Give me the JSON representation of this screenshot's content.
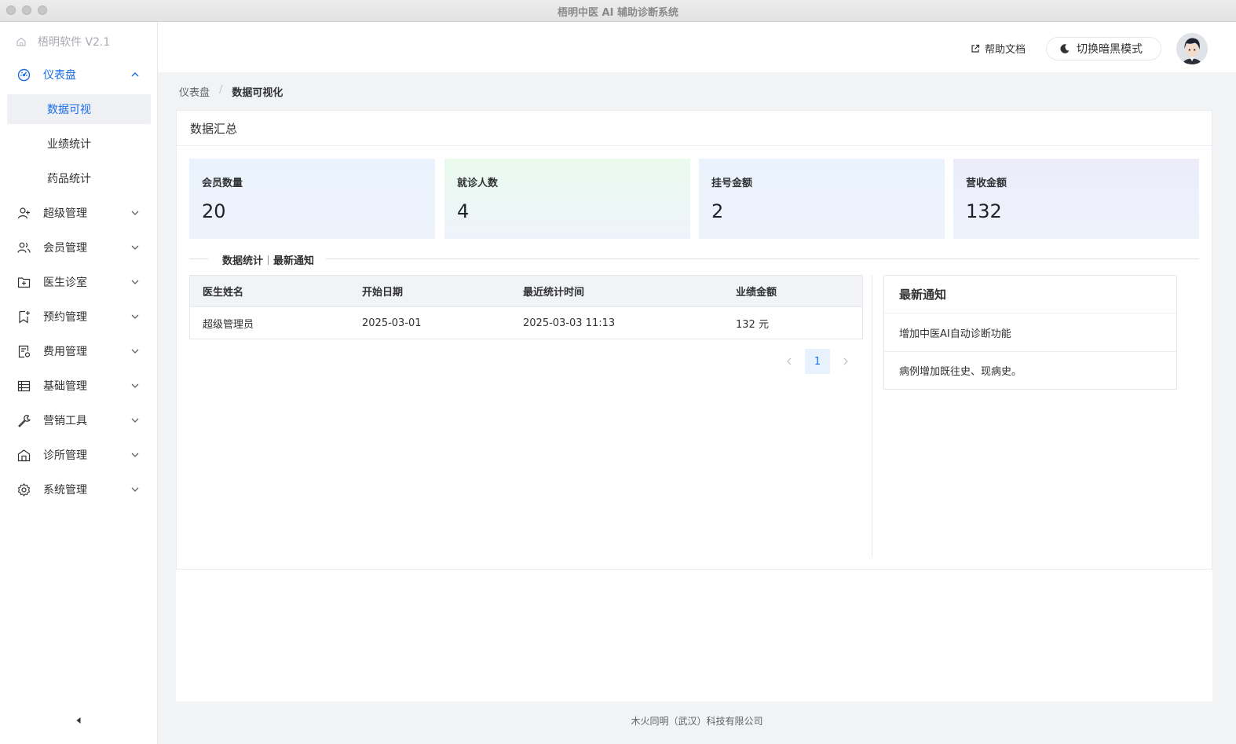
{
  "window": {
    "title": "梧明中医 AI 辅助诊断系统"
  },
  "sidebar": {
    "brand": "梧明软件 V2.1",
    "dashboard": {
      "label": "仪表盘",
      "children": [
        {
          "label": "数据可视",
          "active": true
        },
        {
          "label": "业绩统计"
        },
        {
          "label": "药品统计"
        }
      ]
    },
    "items": [
      {
        "label": "超级管理",
        "icon": "user-add-icon"
      },
      {
        "label": "会员管理",
        "icon": "users-icon"
      },
      {
        "label": "医生诊室",
        "icon": "folder-plus-icon"
      },
      {
        "label": "预约管理",
        "icon": "bookmark-plus-icon"
      },
      {
        "label": "费用管理",
        "icon": "receipt-icon"
      },
      {
        "label": "基础管理",
        "icon": "table-icon"
      },
      {
        "label": "营销工具",
        "icon": "wrench-icon"
      },
      {
        "label": "诊所管理",
        "icon": "clinic-icon"
      },
      {
        "label": "系统管理",
        "icon": "gear-icon"
      }
    ]
  },
  "header": {
    "help_label": "帮助文档",
    "dark_mode_label": "切换暗黑模式"
  },
  "breadcrumb": {
    "parent": "仪表盘",
    "current": "数据可视化"
  },
  "panel": {
    "title": "数据汇总",
    "stats": [
      {
        "label": "会员数量",
        "value": "20",
        "bg": "#eaf3fd"
      },
      {
        "label": "就诊人数",
        "value": "4",
        "bg": "#eafbee"
      },
      {
        "label": "挂号金额",
        "value": "2",
        "bg": "#eaf3fd"
      },
      {
        "label": "营收金额",
        "value": "132",
        "bg": "#ececfb"
      }
    ],
    "divider": {
      "left": "数据统计",
      "right": "最新通知"
    },
    "table": {
      "headers": [
        "医生姓名",
        "开始日期",
        "最近统计时间",
        "业绩金额"
      ],
      "rows": [
        [
          "超级管理员",
          "2025-03-01",
          "2025-03-03 11:13",
          "132 元"
        ]
      ]
    },
    "pagination": {
      "current_page": "1"
    },
    "notices": {
      "title": "最新通知",
      "items": [
        "增加中医AI自动诊断功能",
        "病例增加既往史、现病史。"
      ]
    }
  },
  "footer": {
    "text": "木火同明（武汉）科技有限公司"
  },
  "colors": {
    "accent": "#1a6ce8",
    "content_bg": "#f2f3f5"
  }
}
